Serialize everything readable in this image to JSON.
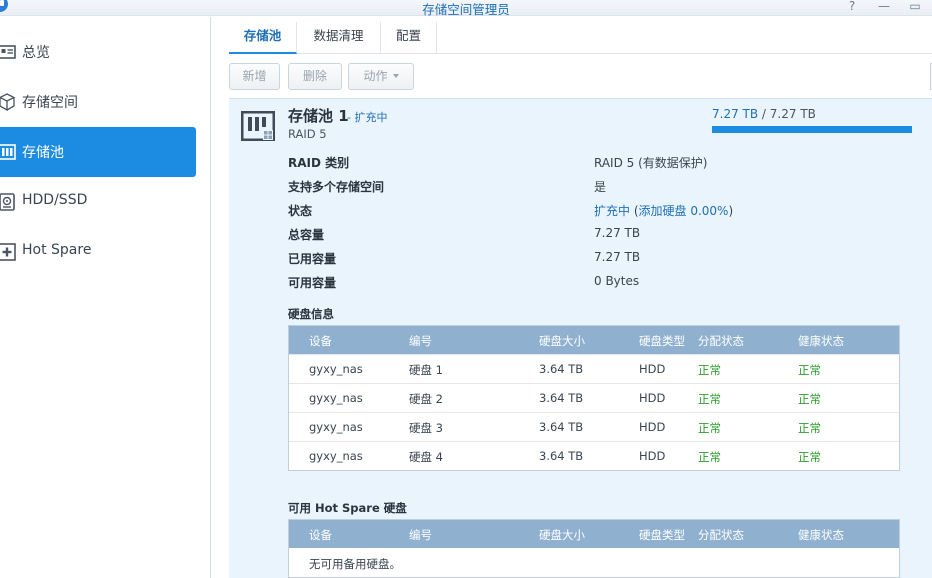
{
  "window": {
    "title": "存储空间管理员",
    "help_glyph": "?",
    "minimize_glyph": "—",
    "maximize_glyph": "▭"
  },
  "sidebar": {
    "items": [
      {
        "label": "总览",
        "icon": "overview-icon",
        "active": false
      },
      {
        "label": "存储空间",
        "icon": "volume-icon",
        "active": false
      },
      {
        "label": "存储池",
        "icon": "storage-pool-icon",
        "active": true
      },
      {
        "label": "HDD/SSD",
        "icon": "hdd-icon",
        "active": false
      },
      {
        "label": "Hot Spare",
        "icon": "hot-spare-icon",
        "active": false
      }
    ]
  },
  "tabs": [
    {
      "label": "存储池",
      "active": true
    },
    {
      "label": "数据清理",
      "active": false
    },
    {
      "label": "配置",
      "active": false
    }
  ],
  "toolbar": {
    "create": "新增",
    "delete": "删除",
    "action": "动作"
  },
  "pool": {
    "name": "存储池 1",
    "status": "- 扩充中",
    "raid": "RAID 5",
    "capacity": {
      "used": "7.27 TB",
      "separator": " / ",
      "total": "7.27 TB",
      "fill_percent": 100
    },
    "properties": [
      {
        "label": "RAID 类别",
        "value": "RAID 5 (有数据保护)"
      },
      {
        "label": "支持多个存储空间",
        "value": "是"
      },
      {
        "label": "状态",
        "value_link": "扩充中",
        "value_paren_open": " (",
        "value_link2": "添加硬盘 0.00%",
        "value_paren_close": ")"
      },
      {
        "label": "总容量",
        "value": "7.27 TB"
      },
      {
        "label": "已用容量",
        "value": "7.27 TB"
      },
      {
        "label": "可用容量",
        "value": "0 Bytes"
      }
    ],
    "disk_section_title": "硬盘信息",
    "disk_columns": [
      "设备",
      "编号",
      "硬盘大小",
      "硬盘类型",
      "分配状态",
      "健康状态"
    ],
    "disks": [
      [
        "gyxy_nas",
        "硬盘 1",
        "3.64 TB",
        "HDD",
        "正常",
        "正常"
      ],
      [
        "gyxy_nas",
        "硬盘 2",
        "3.64 TB",
        "HDD",
        "正常",
        "正常"
      ],
      [
        "gyxy_nas",
        "硬盘 3",
        "3.64 TB",
        "HDD",
        "正常",
        "正常"
      ],
      [
        "gyxy_nas",
        "硬盘 4",
        "3.64 TB",
        "HDD",
        "正常",
        "正常"
      ]
    ],
    "spare_section_title": "可用 Hot Spare 硬盘",
    "spare_columns": [
      "设备",
      "编号",
      "硬盘大小",
      "硬盘类型",
      "分配状态",
      "健康状态"
    ],
    "spare_empty": "无可用备用硬盘。"
  },
  "colors": {
    "accent": "#1c8ce3",
    "ok": "#2c9a2c",
    "grid_header": "#8fb1cf",
    "panel_bg": "#e9f4fc"
  }
}
